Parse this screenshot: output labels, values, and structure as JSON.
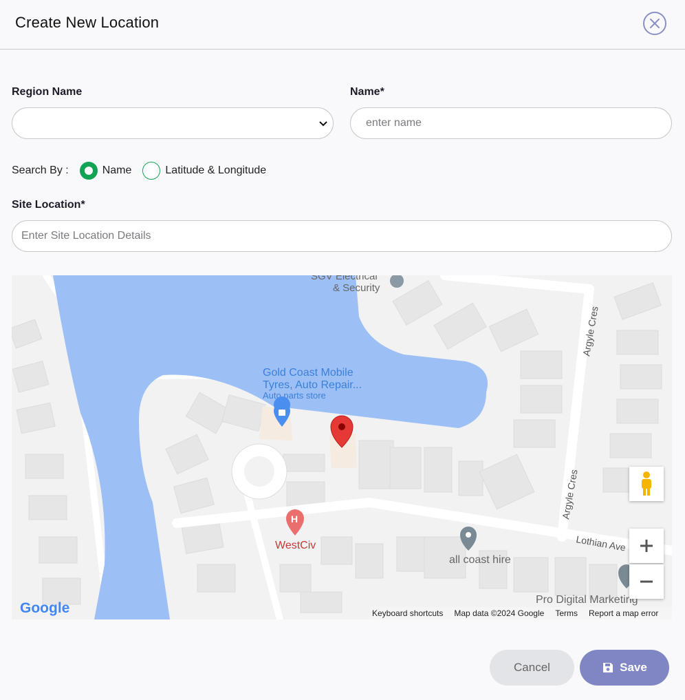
{
  "dialog": {
    "title": "Create New Location"
  },
  "form": {
    "region_label": "Region Name",
    "region_value": "",
    "name_label": "Name*",
    "name_placeholder": "enter name",
    "search_by_label": "Search By :",
    "search_options": [
      {
        "label": "Name",
        "checked": true
      },
      {
        "label": "Latitude & Longitude",
        "checked": false
      }
    ],
    "site_location_label": "Site Location*",
    "site_location_placeholder": "Enter Site Location Details"
  },
  "map": {
    "places": {
      "sgv": [
        "SGV Electrical",
        "& Security"
      ],
      "gold_coast": [
        "Gold Coast Mobile",
        "Tyres, Auto Repair..."
      ],
      "gold_coast_type": "Auto parts store",
      "westciv": "WestCiv",
      "all_coast": "all coast hire",
      "pro_digital": "Pro Digital Marketing"
    },
    "streets": [
      "Argyle Cres",
      "Argyle Cres",
      "Lothian Ave"
    ],
    "logo_text": "Google",
    "attribution": {
      "keyboard": "Keyboard shortcuts",
      "data": "Map data ©2024 Google",
      "terms": "Terms",
      "report": "Report a map error"
    }
  },
  "actions": {
    "cancel": "Cancel",
    "save": "Save"
  },
  "colors": {
    "accent": "#7f86c3",
    "radio": "#13a356",
    "water": "#9cbff6"
  }
}
